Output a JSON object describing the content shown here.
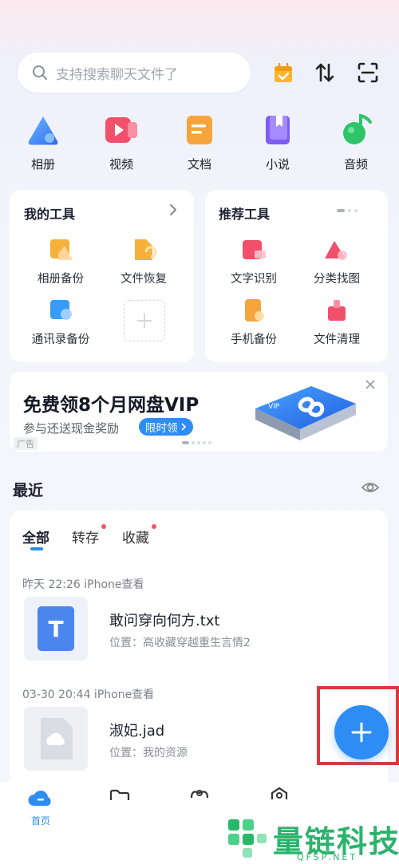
{
  "search": {
    "placeholder": "支持搜索聊天文件了"
  },
  "header_icons": [
    "calendar-check-icon",
    "transfer-icon",
    "scan-icon"
  ],
  "categories": [
    {
      "label": "相册",
      "icon": "album-icon",
      "color": "#3f8cf7"
    },
    {
      "label": "视频",
      "icon": "video-icon",
      "color": "#f0506a"
    },
    {
      "label": "文档",
      "icon": "document-icon",
      "color": "#f4a135"
    },
    {
      "label": "小说",
      "icon": "novel-icon",
      "color": "#7b5cf0"
    },
    {
      "label": "音频",
      "icon": "audio-icon",
      "color": "#2fc46a"
    }
  ],
  "my_tools": {
    "title": "我的工具",
    "items": [
      {
        "label": "相册备份",
        "icon": "album-backup-icon"
      },
      {
        "label": "文件恢复",
        "icon": "file-recovery-icon"
      },
      {
        "label": "通讯录备份",
        "icon": "contacts-backup-icon"
      }
    ]
  },
  "recommended_tools": {
    "title": "推荐工具",
    "items": [
      {
        "label": "文字识别",
        "icon": "ocr-icon"
      },
      {
        "label": "分类找图",
        "icon": "photo-search-icon"
      },
      {
        "label": "手机备份",
        "icon": "phone-backup-icon"
      },
      {
        "label": "文件清理",
        "icon": "file-clean-icon"
      }
    ]
  },
  "ad": {
    "title": "免费领8个月网盘VIP",
    "subtitle": "参与还送现金奖励",
    "cta": "限时领",
    "tag": "广告",
    "device_label": "VIP"
  },
  "recent": {
    "title": "最近",
    "tabs": [
      {
        "label": "全部",
        "active": true,
        "badge": false
      },
      {
        "label": "转存",
        "active": false,
        "badge": true
      },
      {
        "label": "收藏",
        "active": false,
        "badge": true
      }
    ],
    "files": [
      {
        "time": "昨天 22:26 iPhone查看",
        "name": "敢问穿向何方.txt",
        "location": "位置：高收藏穿越重生言情2",
        "icon_letter": "T"
      },
      {
        "time": "03-30 20:44 iPhone查看",
        "name": "淑妃.jad",
        "location": "位置：我的资源",
        "icon_letter": ""
      }
    ]
  },
  "bottom_nav": [
    {
      "label": "首页",
      "icon": "home-cloud-icon",
      "active": true
    },
    {
      "label": "",
      "icon": "files-icon",
      "active": false
    },
    {
      "label": "",
      "icon": "share-icon",
      "active": false
    },
    {
      "label": "",
      "icon": "profile-icon",
      "active": false
    }
  ],
  "watermark": {
    "text": "量链科技",
    "sub": "QFSP.NET"
  },
  "colors": {
    "accent": "#2e8cf5",
    "badge": "#f2556a",
    "highlight_frame": "#d93a3a"
  }
}
